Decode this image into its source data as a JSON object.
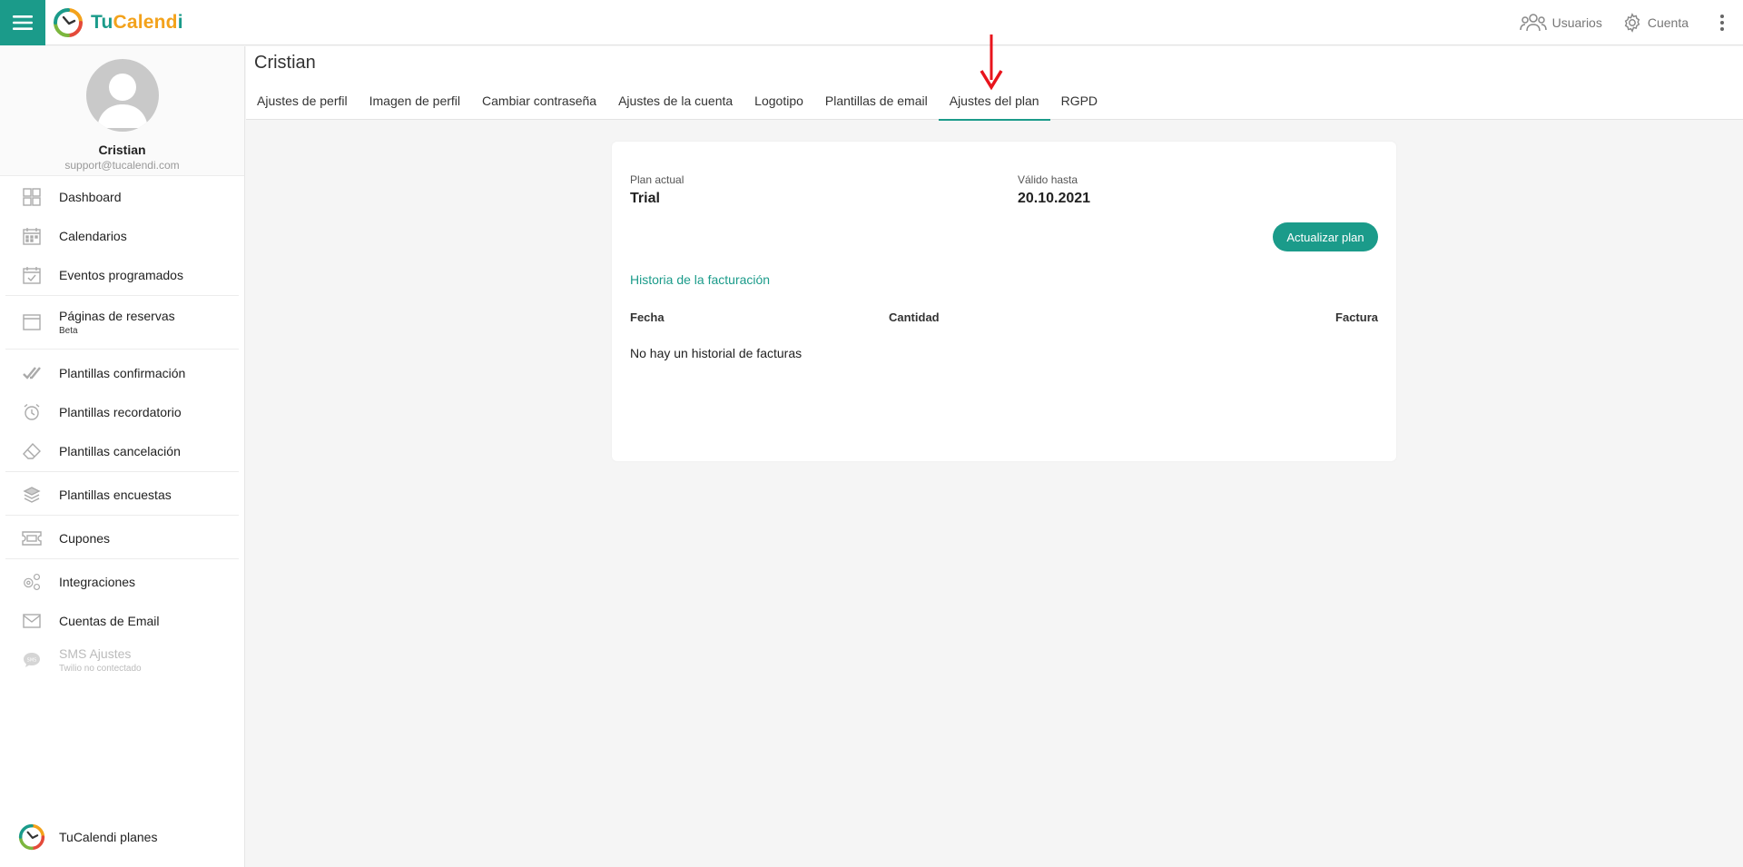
{
  "app": {
    "brand_part1": "Tu",
    "brand_part2": "Calend",
    "brand_part3": "i",
    "accent_color": "#1b9b8a",
    "brand_orange": "#f3a21b"
  },
  "topbar": {
    "users_label": "Usuarios",
    "account_label": "Cuenta"
  },
  "profile": {
    "name": "Cristian",
    "email": "support@tucalendi.com"
  },
  "sidebar": {
    "items": [
      {
        "label": "Dashboard",
        "icon": "dashboard-icon"
      },
      {
        "label": "Calendarios",
        "icon": "calendar-icon"
      },
      {
        "label": "Eventos programados",
        "icon": "calendar-check-icon"
      },
      {
        "label": "Páginas de reservas",
        "sub": "Beta",
        "icon": "browser-window-icon"
      },
      {
        "label": "Plantillas confirmación",
        "icon": "double-check-icon"
      },
      {
        "label": "Plantillas recordatorio",
        "icon": "alarm-clock-icon"
      },
      {
        "label": "Plantillas cancelación",
        "icon": "eraser-icon"
      },
      {
        "label": "Plantillas encuestas",
        "icon": "layers-icon"
      },
      {
        "label": "Cupones",
        "icon": "coupon-icon"
      },
      {
        "label": "Integraciones",
        "icon": "gears-icon"
      },
      {
        "label": "Cuentas de Email",
        "icon": "envelope-icon"
      },
      {
        "label": "SMS Ajustes",
        "sub": "Twilio no contectado",
        "icon": "sms-bubble-icon",
        "disabled": true
      }
    ],
    "footer_label": "TuCalendi planes"
  },
  "main": {
    "title": "Cristian",
    "tabs": [
      {
        "label": "Ajustes de perfil"
      },
      {
        "label": "Imagen de perfil"
      },
      {
        "label": "Cambiar contraseña"
      },
      {
        "label": "Ajustes de la cuenta"
      },
      {
        "label": "Logotipo"
      },
      {
        "label": "Plantillas de email"
      },
      {
        "label": "Ajustes del plan",
        "active": true
      },
      {
        "label": "RGPD"
      }
    ]
  },
  "plan": {
    "current_label": "Plan actual",
    "current_value": "Trial",
    "valid_label": "Válido hasta",
    "valid_value": "20.10.2021",
    "upgrade_button": "Actualizar plan",
    "billing_history_link": "Historia de la facturación",
    "columns": {
      "date": "Fecha",
      "amount": "Cantidad",
      "invoice": "Factura"
    },
    "empty_message": "No hay un historial de facturas"
  }
}
